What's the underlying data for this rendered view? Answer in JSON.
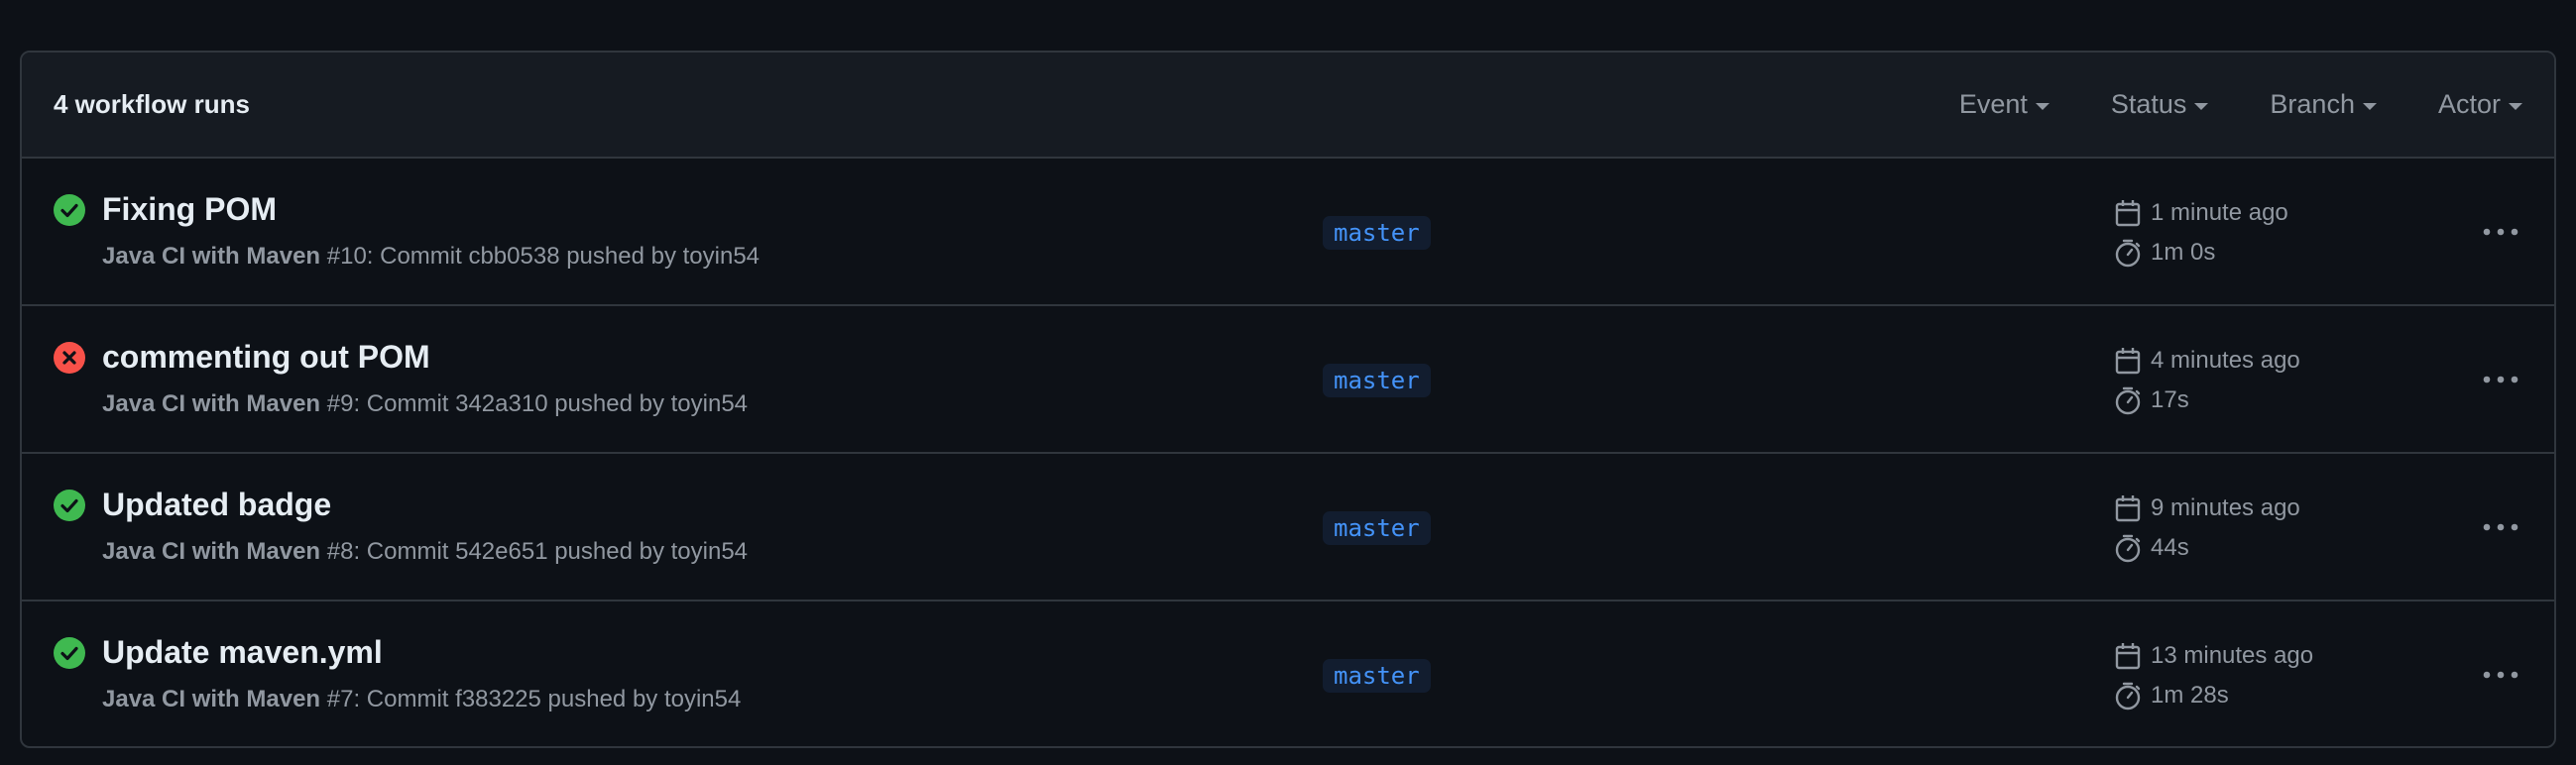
{
  "header": {
    "run_count": "4 workflow runs",
    "filters": [
      {
        "label": "Event"
      },
      {
        "label": "Status"
      },
      {
        "label": "Branch"
      },
      {
        "label": "Actor"
      }
    ]
  },
  "colors": {
    "success": "#3fb950",
    "failure": "#f85149",
    "branch_text": "#4493f8",
    "branch_bg": "#121d2f"
  },
  "runs": [
    {
      "status": "success",
      "status_icon": "check-circle-icon",
      "title": "Fixing POM",
      "workflow": "Java CI with Maven",
      "detail": " #10: Commit cbb0538 pushed by toyin54",
      "branch": "master",
      "time_ago": "1 minute ago",
      "duration": "1m 0s"
    },
    {
      "status": "failure",
      "status_icon": "x-circle-icon",
      "title": "commenting out POM",
      "workflow": "Java CI with Maven",
      "detail": " #9: Commit 342a310 pushed by toyin54",
      "branch": "master",
      "time_ago": "4 minutes ago",
      "duration": "17s"
    },
    {
      "status": "success",
      "status_icon": "check-circle-icon",
      "title": "Updated badge",
      "workflow": "Java CI with Maven",
      "detail": " #8: Commit 542e651 pushed by toyin54",
      "branch": "master",
      "time_ago": "9 minutes ago",
      "duration": "44s"
    },
    {
      "status": "success",
      "status_icon": "check-circle-icon",
      "title": "Update maven.yml",
      "workflow": "Java CI with Maven",
      "detail": " #7: Commit f383225 pushed by toyin54",
      "branch": "master",
      "time_ago": "13 minutes ago",
      "duration": "1m 28s"
    }
  ]
}
